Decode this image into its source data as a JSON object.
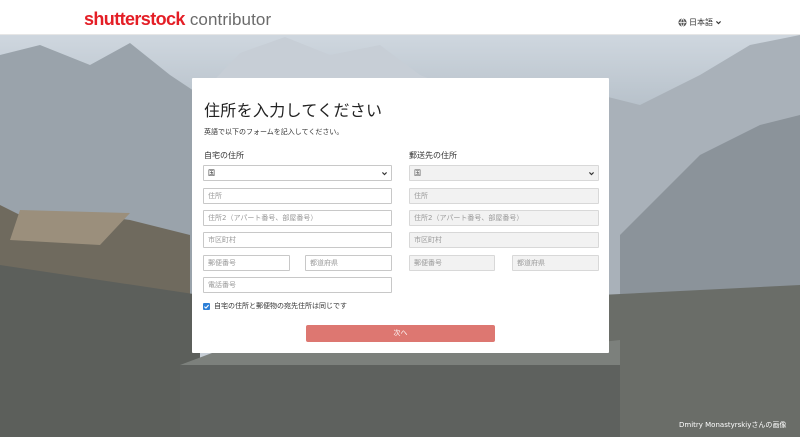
{
  "header": {
    "logo_brand": "shutterstock",
    "logo_suffix": "contributor",
    "language": "日本語"
  },
  "card": {
    "title": "住所を入力してください",
    "subtitle": "英語で以下のフォームを記入してください。",
    "home": {
      "heading": "自宅の住所",
      "country": "国",
      "address": "住所",
      "address2": "住所2（アパート番号、部屋番号）",
      "city": "市区町村",
      "postal": "郵便番号",
      "prefecture": "都道府県",
      "phone": "電話番号"
    },
    "mailing": {
      "heading": "郵送先の住所",
      "country": "国",
      "address": "住所",
      "address2": "住所2（アパート番号、部屋番号）",
      "city": "市区町村",
      "postal": "郵便番号",
      "prefecture": "都道府県"
    },
    "same_address_label": "自宅の住所と郵便物の宛先住所は同じです",
    "same_address_checked": true,
    "next_button": "次へ"
  },
  "photo_credit": "Dmitry Monastyrskiyさんの画像",
  "colors": {
    "brand_red": "#e41e26",
    "button": "#dd7771",
    "checkbox": "#2d7fd7"
  }
}
